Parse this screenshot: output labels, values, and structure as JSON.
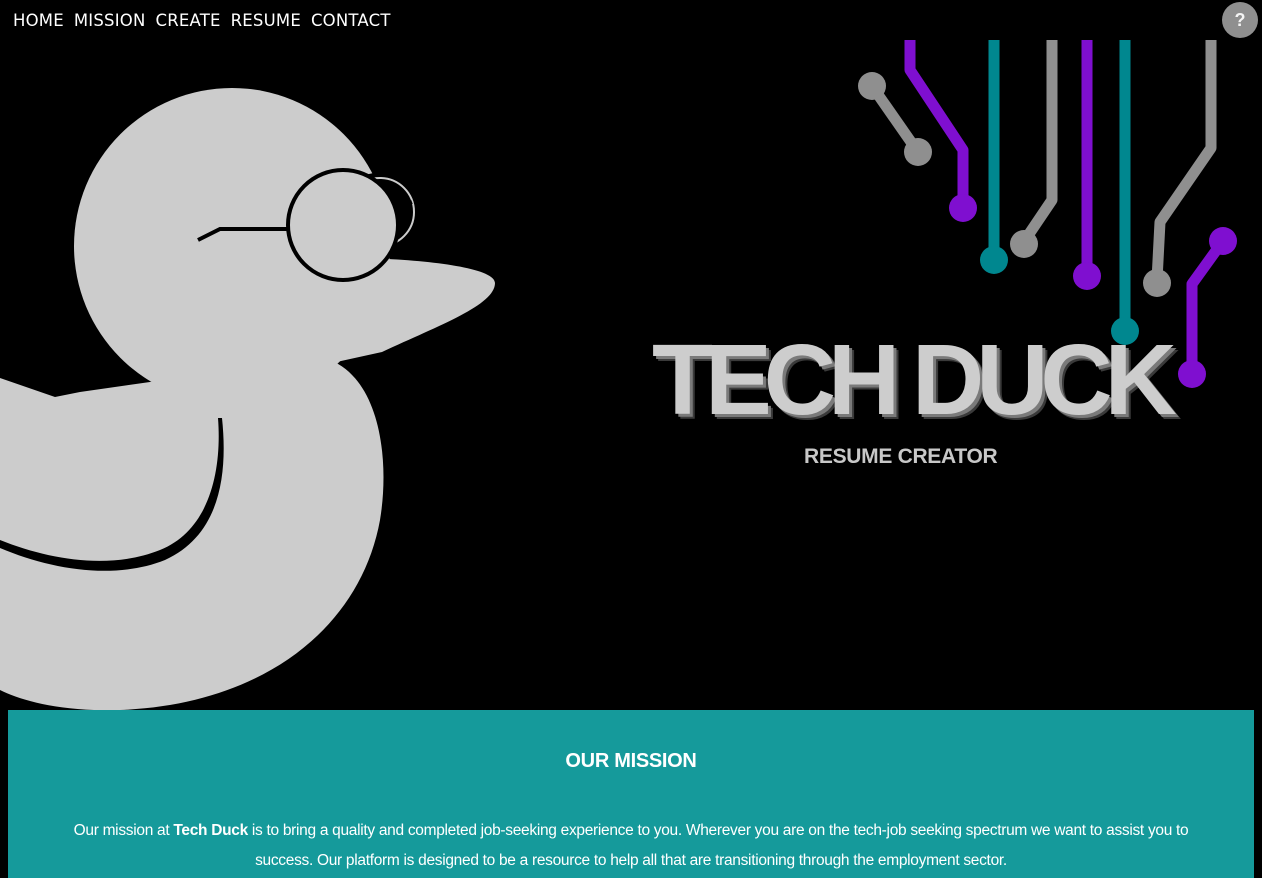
{
  "nav": {
    "items": [
      "HOME",
      "MISSION",
      "CREATE",
      "RESUME",
      "CONTACT"
    ],
    "help_label": "?"
  },
  "hero": {
    "title": "TECH DUCK",
    "subtitle": "RESUME CREATOR",
    "icons": [
      "duck-mascot-icon",
      "circuit-lines-icon"
    ]
  },
  "mission": {
    "heading": "OUR MISSION",
    "text_before": "Our mission at ",
    "brand": "Tech Duck",
    "text_after": " is to bring a quality and completed job-seeking experience to you. Wherever you are on the tech-job seeking spectrum we want to assist you to success. Our platform is designed to be a resource to help all that are transitioning through the employment sector."
  },
  "colors": {
    "background": "#000000",
    "duck": "#cccccc",
    "mission_bg": "#159a9b",
    "circuit_purple": "#7f0fd0",
    "circuit_teal": "#00878f",
    "circuit_gray": "#8f8f8f"
  }
}
